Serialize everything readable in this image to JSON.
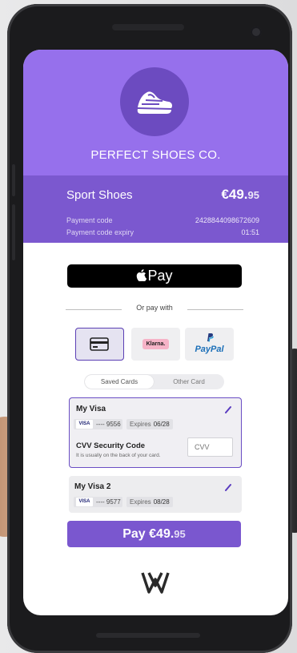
{
  "brand": {
    "name": "PERFECT SHOES CO.",
    "logo_icon": "shoe-icon"
  },
  "order": {
    "product": "Sport Shoes",
    "price_main": "€49.",
    "price_cents": "95",
    "payment_code_label": "Payment code",
    "payment_code_value": "2428844098672609",
    "expiry_label": "Payment code expiry",
    "expiry_value": "01:51"
  },
  "apple_pay": {
    "label": "Pay",
    "icon": "apple-icon"
  },
  "or_pay_with": "Or pay with",
  "payment_methods": [
    {
      "name": "Card",
      "icon": "credit-card-icon",
      "selected": true
    },
    {
      "name": "Klarna.",
      "icon": "klarna-logo"
    },
    {
      "name": "PayPal",
      "icon": "paypal-logo"
    }
  ],
  "tabs": {
    "saved": "Saved Cards",
    "other": "Other Card",
    "selected": "saved"
  },
  "cards": [
    {
      "title": "My Visa",
      "brand": "VISA",
      "number": "---- 9556",
      "expires_label": "Expires",
      "expires": "06/28",
      "selected": true
    },
    {
      "title": "My Visa 2",
      "brand": "VISA",
      "number": "---- 9577",
      "expires_label": "Expires",
      "expires": "08/28",
      "selected": false
    }
  ],
  "cvv": {
    "title": "CVV Security Code",
    "hint": "It is usually on the back of your card.",
    "placeholder": "CVV"
  },
  "pay_button": {
    "label": "Pay",
    "price_main": "€49.",
    "price_cents": "95"
  },
  "colors": {
    "accent": "#9670ec",
    "accent_dark": "#7b58cf",
    "logo_bg": "#6c4bc0"
  }
}
